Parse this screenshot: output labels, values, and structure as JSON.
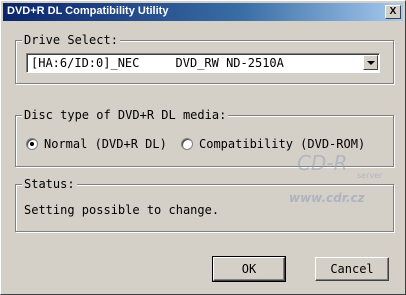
{
  "window": {
    "title": "DVD+R DL Compatibility Utility",
    "close_label": "X"
  },
  "drive_select": {
    "legend": "Drive Select:",
    "selected": "[HA:6/ID:0]_NEC     DVD_RW ND-2510A"
  },
  "disc_type": {
    "legend": "Disc type of DVD+R DL media:",
    "options": [
      {
        "label": "Normal (DVD+R DL)",
        "checked": true
      },
      {
        "label": "Compatibility (DVD-ROM)",
        "checked": false
      }
    ]
  },
  "status": {
    "legend": "Status:",
    "text": "Setting possible to change."
  },
  "watermark": {
    "brand": "CD-R",
    "sub": "server",
    "url": "www.cdr.cz"
  },
  "buttons": {
    "ok": "OK",
    "cancel": "Cancel"
  }
}
